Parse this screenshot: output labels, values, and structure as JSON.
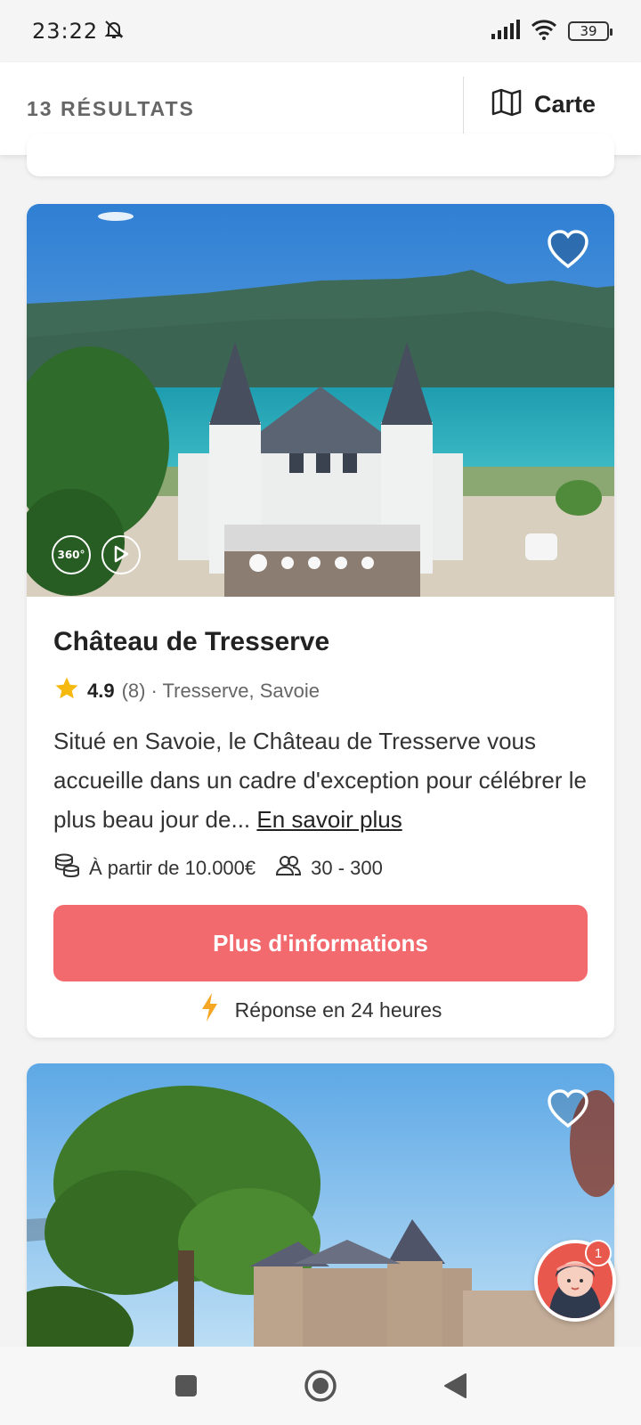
{
  "status_bar": {
    "time": "23:22",
    "battery": "39"
  },
  "header": {
    "results_count": "13 RÉSULTATS",
    "map_label": "Carte"
  },
  "listing": {
    "title": "Château de Tresserve",
    "rating": "4.9",
    "review_count": "(8)",
    "location": "· Tresserve, Savoie",
    "description": "Situé en Savoie, le Château de Tresserve vous accueille dans un cadre d'exception pour célébrer le plus beau jour de...",
    "read_more": "En savoir plus",
    "price": "À partir de 10.000€",
    "capacity": "30 - 300",
    "cta": "Plus d'informations",
    "response": "Réponse en 24 heures",
    "media_360": "360°",
    "photo_count": 5,
    "active_photo": 1
  },
  "chat": {
    "badge": "1"
  },
  "colors": {
    "accent": "#f26a6d",
    "star": "#f5b90f"
  }
}
